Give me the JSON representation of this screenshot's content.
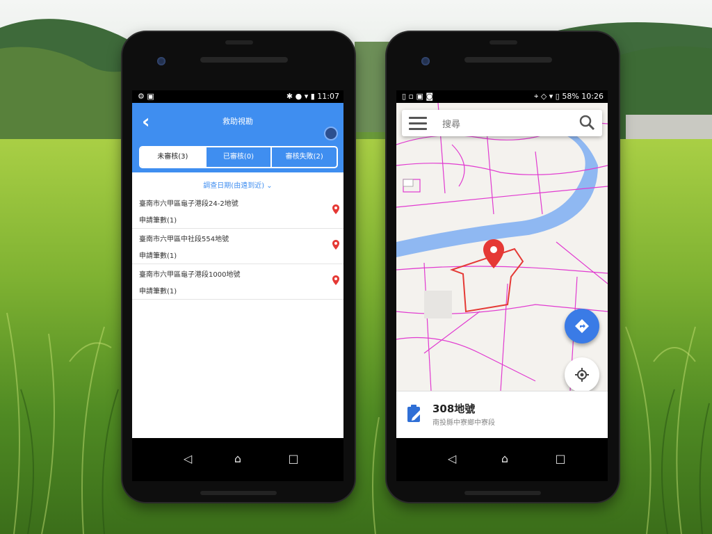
{
  "left_phone": {
    "status": {
      "left_icons": "⚙ ▣",
      "right_icons": "✱ ● ▾ ▮",
      "time": "11:07"
    },
    "header": {
      "back_label": "‹",
      "title": "救助視勘"
    },
    "tabs": [
      {
        "label": "未審核(3)",
        "active": true
      },
      {
        "label": "已審核(0)",
        "active": false
      },
      {
        "label": "審核失敗(2)",
        "active": false
      }
    ],
    "sort_label": "調查日期(由遠到近)",
    "items": [
      {
        "address": "臺南市六甲區龜子港段24-2地號",
        "count": "申請筆數(1)"
      },
      {
        "address": "臺南市六甲區中社段554地號",
        "count": "申請筆數(1)"
      },
      {
        "address": "臺南市六甲區龜子港段1000地號",
        "count": "申請筆數(1)"
      }
    ],
    "nav": {
      "back": "◁",
      "home": "⌂",
      "recent": "□"
    }
  },
  "right_phone": {
    "status": {
      "left_icons": "▯ ▫ ▣ ◙",
      "right_icons": "⌖ ◇ ▾ ▯",
      "battery": "58%",
      "time": "10:26"
    },
    "search": {
      "placeholder": "搜尋"
    },
    "sheet": {
      "title": "308地號",
      "subtitle": "南投縣中寮鄉中寮段"
    },
    "nav": {
      "back": "◁",
      "home": "⌂",
      "recent": "□"
    }
  },
  "colors": {
    "accent": "#3f8ef0",
    "pin": "#e53935",
    "parcel": "#e13ad0",
    "river": "#8fb8f2"
  }
}
